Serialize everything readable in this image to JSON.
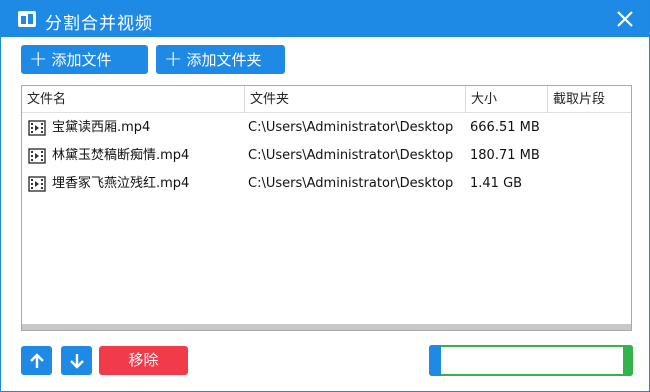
{
  "window": {
    "title": "分割合并视频"
  },
  "toolbar": {
    "add_file_label": "添加文件",
    "add_folder_label": "添加文件夹"
  },
  "table": {
    "columns": [
      "文件名",
      "文件夹",
      "大小",
      "截取片段"
    ],
    "rows": [
      {
        "name": "宝黛读西厢.mp4",
        "folder": "C:\\Users\\Administrator\\Desktop",
        "size": "666.51 MB",
        "clip": ""
      },
      {
        "name": "林黛玉焚稿断痴情.mp4",
        "folder": "C:\\Users\\Administrator\\Desktop",
        "size": "180.71 MB",
        "clip": ""
      },
      {
        "name": "埋香冢飞燕泣残红.mp4",
        "folder": "C:\\Users\\Administrator\\Desktop",
        "size": "1.41 GB",
        "clip": ""
      }
    ]
  },
  "bottom": {
    "remove_label": "移除",
    "start_label": ""
  },
  "colors": {
    "primary": "#1f8ae6",
    "danger": "#f23b4a",
    "success": "#34b34a"
  }
}
